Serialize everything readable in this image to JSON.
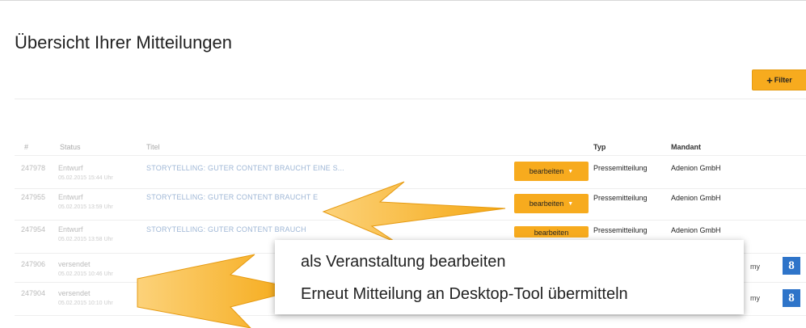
{
  "page": {
    "title": "Übersicht Ihrer Mitteilungen"
  },
  "toolbar": {
    "filter_label": "Filter",
    "filter_icon": "plus-icon"
  },
  "table": {
    "headers": {
      "id": "#",
      "status": "Status",
      "title": "Titel",
      "typ": "Typ",
      "mandant": "Mandant"
    },
    "rows": [
      {
        "id": "247978",
        "status": "Entwurf",
        "date": "05.02.2015 15:44 Uhr",
        "title": "STORYTELLING: GUTER CONTENT BRAUCHT EINE S...",
        "action": "bearbeiten",
        "typ": "Pressemitteilung",
        "mandant": "Adenion GmbH"
      },
      {
        "id": "247955",
        "status": "Entwurf",
        "date": "05.02.2015 13:59 Uhr",
        "title": "STORYTELLING: GUTER CONTENT BRAUCHT E",
        "action": "bearbeiten",
        "typ": "Pressemitteilung",
        "mandant": "Adenion GmbH"
      },
      {
        "id": "247954",
        "status": "Entwurf",
        "date": "05.02.2015 13:58 Uhr",
        "title": "STORYTELLING: GUTER CONTENT BRAUCH",
        "action": "bearbeiten",
        "typ": "Pressemitteilung",
        "mandant": "Adenion GmbH"
      },
      {
        "id": "247906",
        "status": "versendet",
        "date": "05.02.2015 10:46 Uhr",
        "title": "",
        "typ": "",
        "mandant": "my"
      },
      {
        "id": "247904",
        "status": "versendet",
        "date": "05.02.2015 10:10 Uhr",
        "title": "",
        "typ": "",
        "mandant": "my"
      }
    ]
  },
  "dropdown": {
    "items": [
      "als Veranstaltung bearbeiten",
      "Erneut Mitteilung an Desktop-Tool übermitteln"
    ]
  },
  "icons": {
    "share": "google-plus-icon",
    "share_glyph": "8"
  },
  "colors": {
    "accent": "#f7ab1e",
    "link": "#9fb7d6",
    "gplus": "#2e74c9"
  }
}
